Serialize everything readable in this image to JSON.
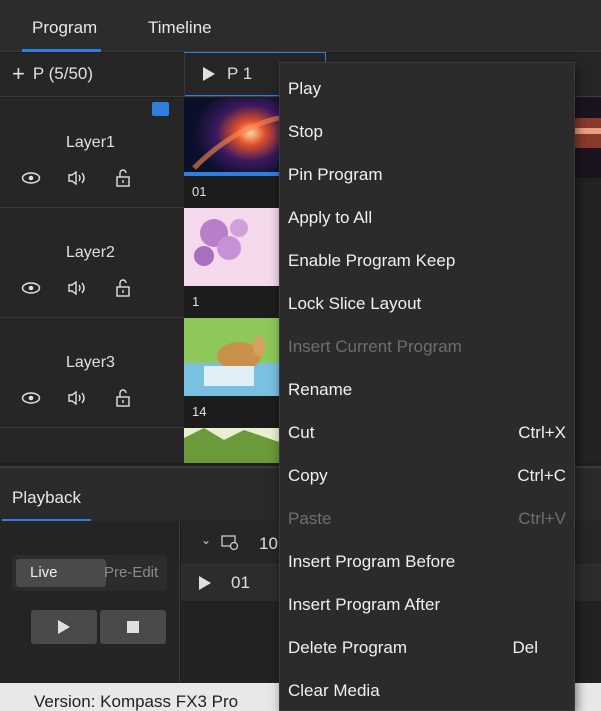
{
  "tabs": {
    "program": "Program",
    "timeline": "Timeline"
  },
  "program_header": {
    "add_label": "P (5/50)",
    "program_label": "P 1"
  },
  "layers": [
    {
      "name": "Layer1",
      "thumb_caption": "01"
    },
    {
      "name": "Layer2",
      "thumb_caption": "1"
    },
    {
      "name": "Layer3",
      "thumb_caption": "14"
    }
  ],
  "playback": {
    "tab": "Playback",
    "mode_live": "Live",
    "mode_pre_edit": "Pre-Edit",
    "list_header": "10",
    "list_item": "01"
  },
  "footer": {
    "version": "Version: Kompass FX3 Pro"
  },
  "context_menu": {
    "items": [
      {
        "label": "Play",
        "shortcut": "",
        "enabled": true
      },
      {
        "label": "Stop",
        "shortcut": "",
        "enabled": true
      },
      {
        "label": "Pin Program",
        "shortcut": "",
        "enabled": true
      },
      {
        "label": "Apply to All",
        "shortcut": "",
        "enabled": true
      },
      {
        "label": "Enable Program Keep",
        "shortcut": "",
        "enabled": true
      },
      {
        "label": "Lock Slice Layout",
        "shortcut": "",
        "enabled": true
      },
      {
        "label": "Insert Current Program",
        "shortcut": "",
        "enabled": false
      },
      {
        "label": "Rename",
        "shortcut": "",
        "enabled": true
      },
      {
        "label": "Cut",
        "shortcut": "Ctrl+X",
        "enabled": true
      },
      {
        "label": "Copy",
        "shortcut": "Ctrl+C",
        "enabled": true
      },
      {
        "label": "Paste",
        "shortcut": "Ctrl+V",
        "enabled": false
      },
      {
        "label": "Insert Program Before",
        "shortcut": "",
        "enabled": true
      },
      {
        "label": "Insert Program After",
        "shortcut": "",
        "enabled": true
      },
      {
        "label": "Delete Program",
        "shortcut": "Del",
        "enabled": true
      },
      {
        "label": "Clear Media",
        "shortcut": "",
        "enabled": true
      }
    ]
  },
  "colors": {
    "accent": "#2f7fe0",
    "menu_bg": "#2b2b2b",
    "disabled_text": "#6e6e6e"
  }
}
